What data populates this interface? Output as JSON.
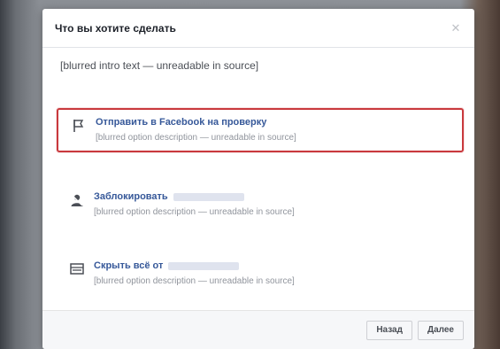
{
  "dialog": {
    "title": "Что вы хотите сделать",
    "intro": "[blurred intro text — unreadable in source]",
    "options": [
      {
        "title": "Отправить в Facebook на проверку",
        "description": "[blurred option description — unreadable in source]",
        "icon": "flag-icon"
      },
      {
        "title": "Заблокировать",
        "description": "[blurred option description — unreadable in source]",
        "icon": "block-icon"
      },
      {
        "title": "Скрыть всё от",
        "description": "[blurred option description — unreadable in source]",
        "icon": "hide-icon"
      }
    ],
    "footer": {
      "back_label": "Назад",
      "next_label": "Далее"
    }
  },
  "colors": {
    "accent_red": "#c9393d",
    "link_blue": "#365899"
  }
}
